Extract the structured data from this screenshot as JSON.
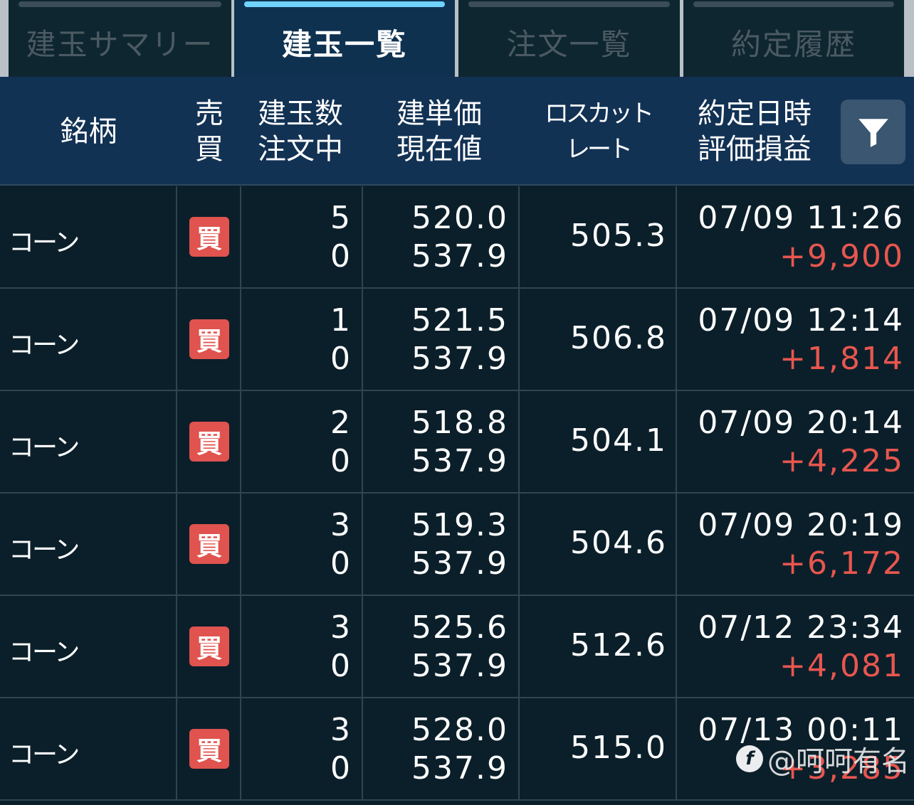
{
  "tabs": [
    {
      "label": "建玉サマリー",
      "active": false
    },
    {
      "label": "建玉一覧",
      "active": true
    },
    {
      "label": "注文一覧",
      "active": false
    },
    {
      "label": "約定履歴",
      "active": false
    }
  ],
  "header": {
    "symbol": "銘柄",
    "side_1": "売",
    "side_2": "買",
    "qty_1": "建玉数",
    "qty_2": "注文中",
    "price_1": "建単価",
    "price_2": "現在値",
    "loss_1": "ロスカット",
    "loss_2": "レート",
    "date_1": "約定日時",
    "date_2": "評価損益",
    "filter_icon": "filter-funnel-icon"
  },
  "colors": {
    "buy_badge": "#e0534e",
    "profit": "#e8564f",
    "active_tab_indicator": "#6fd2ff",
    "header_bg": "#123254"
  },
  "positions": [
    {
      "symbol": "コーン",
      "side": "買",
      "qty": "5",
      "pending": "0",
      "open_price": "520.0",
      "current_price": "537.9",
      "losscut": "505.3",
      "datetime": "07/09 11:26",
      "pnl": "+9,900"
    },
    {
      "symbol": "コーン",
      "side": "買",
      "qty": "1",
      "pending": "0",
      "open_price": "521.5",
      "current_price": "537.9",
      "losscut": "506.8",
      "datetime": "07/09 12:14",
      "pnl": "+1,814"
    },
    {
      "symbol": "コーン",
      "side": "買",
      "qty": "2",
      "pending": "0",
      "open_price": "518.8",
      "current_price": "537.9",
      "losscut": "504.1",
      "datetime": "07/09 20:14",
      "pnl": "+4,225"
    },
    {
      "symbol": "コーン",
      "side": "買",
      "qty": "3",
      "pending": "0",
      "open_price": "519.3",
      "current_price": "537.9",
      "losscut": "504.6",
      "datetime": "07/09 20:19",
      "pnl": "+6,172"
    },
    {
      "symbol": "コーン",
      "side": "買",
      "qty": "3",
      "pending": "0",
      "open_price": "525.6",
      "current_price": "537.9",
      "losscut": "512.6",
      "datetime": "07/12 23:34",
      "pnl": "+4,081"
    },
    {
      "symbol": "コーン",
      "side": "買",
      "qty": "3",
      "pending": "0",
      "open_price": "528.0",
      "current_price": "537.9",
      "losscut": "515.0",
      "datetime": "07/13 00:11",
      "pnl": "+3,285"
    }
  ],
  "watermark": "@呵呵有名"
}
